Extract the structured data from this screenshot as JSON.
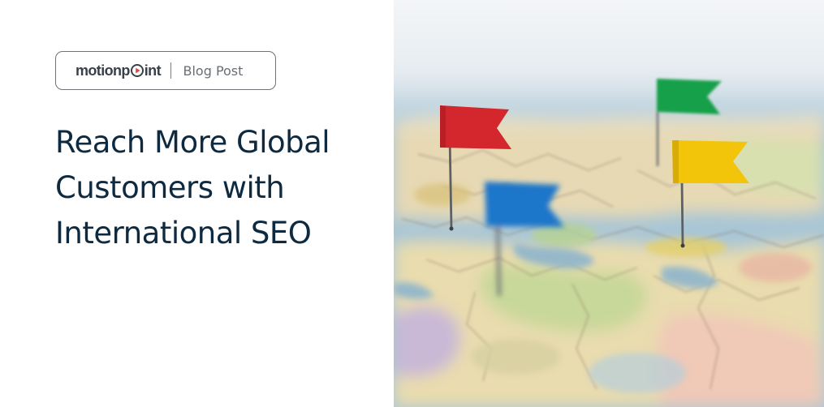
{
  "brand": {
    "name_part1": "motionp",
    "name_part2": "int",
    "logo_icon": "play-triangle-icon"
  },
  "badge": {
    "label": "Blog Post"
  },
  "headline": {
    "line1": "Reach More Global",
    "line2": "Customers with",
    "line3": "International SEO"
  },
  "photo": {
    "subject": "map-with-pushpin-flags",
    "flag_colors": {
      "red": "#d4262d",
      "green": "#18a04a",
      "yellow": "#f2c40a",
      "blue": "#1f76c9"
    }
  },
  "colors": {
    "headline": "#0d2a40",
    "badge_border": "#6f7378",
    "badge_text": "#6a6e74"
  }
}
